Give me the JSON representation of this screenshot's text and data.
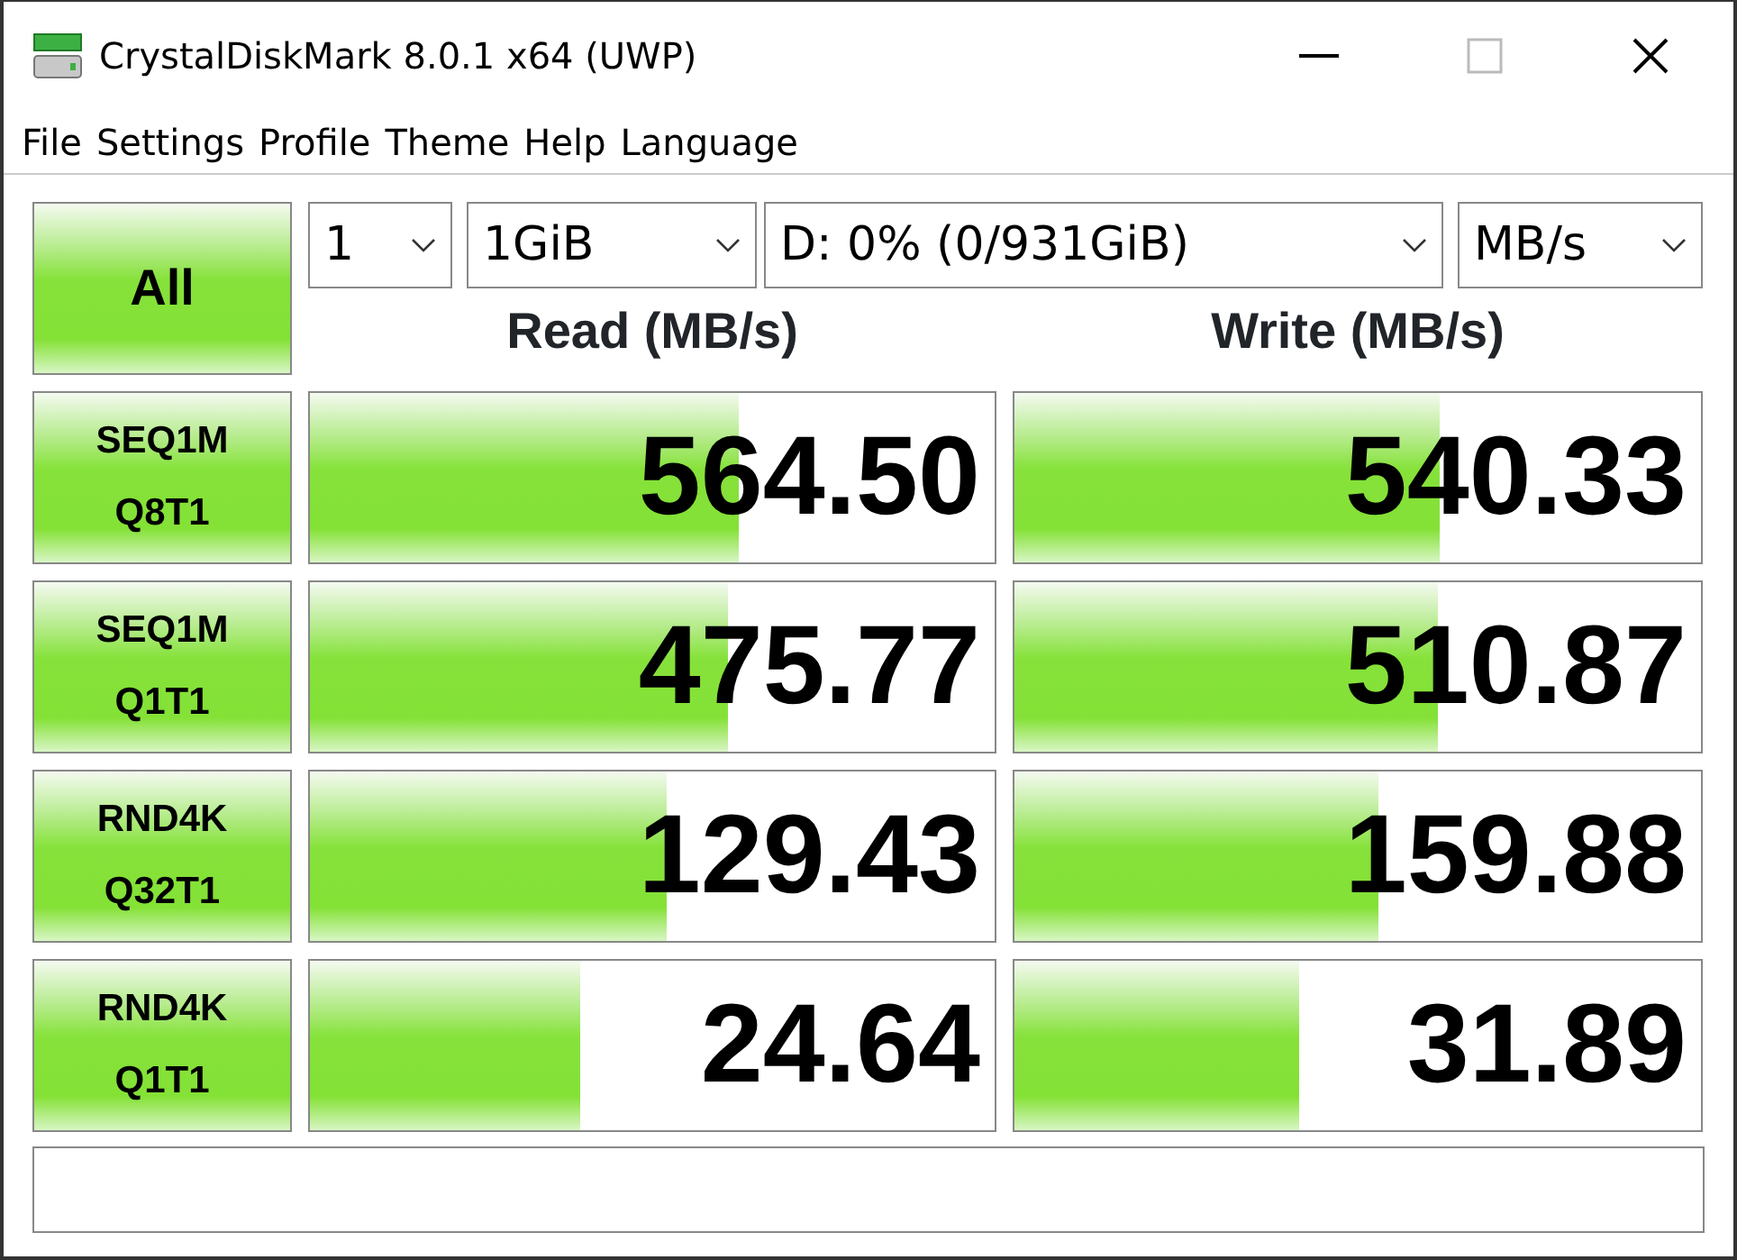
{
  "window": {
    "title": "CrystalDiskMark 8.0.1 x64 (UWP)"
  },
  "menu": [
    "File",
    "Settings",
    "Profile",
    "Theme",
    "Help",
    "Language"
  ],
  "all_button": "All",
  "settings": {
    "count": "1",
    "size": "1GiB",
    "drive": "D: 0% (0/931GiB)",
    "unit": "MB/s"
  },
  "columns": [
    "Read (MB/s)",
    "Write (MB/s)"
  ],
  "tests": [
    {
      "label": "SEQ1M",
      "sublabel": "Q8T1",
      "read": {
        "value": "564.50",
        "level": 0.625
      },
      "write": {
        "value": "540.33",
        "level": 0.62
      }
    },
    {
      "label": "SEQ1M",
      "sublabel": "Q1T1",
      "read": {
        "value": "475.77",
        "level": 0.61
      },
      "write": {
        "value": "510.87",
        "level": 0.617
      }
    },
    {
      "label": "RND4K",
      "sublabel": "Q32T1",
      "read": {
        "value": "129.43",
        "level": 0.52
      },
      "write": {
        "value": "159.88",
        "level": 0.53
      }
    },
    {
      "label": "RND4K",
      "sublabel": "Q1T1",
      "read": {
        "value": "24.64",
        "level": 0.395
      },
      "write": {
        "value": "31.89",
        "level": 0.415
      }
    }
  ]
}
